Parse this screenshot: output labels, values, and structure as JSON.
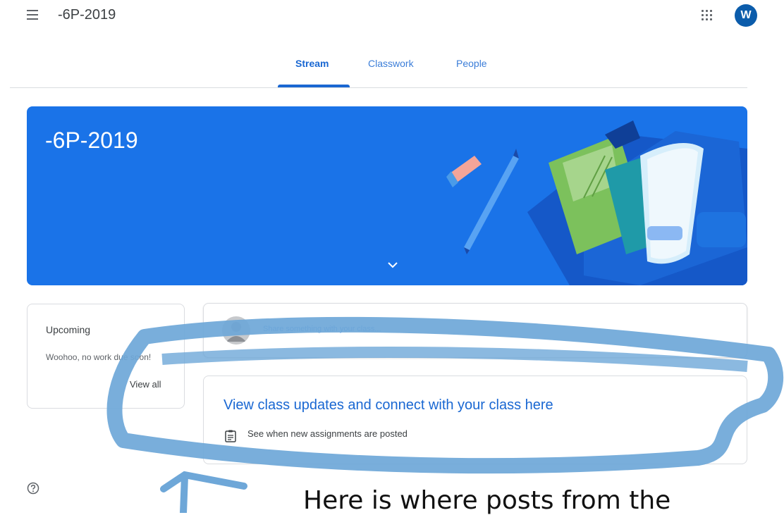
{
  "header": {
    "class_name": "-6P-2019",
    "avatar_letter": "W",
    "icons": [
      "menu-icon",
      "apps-icon",
      "account-avatar"
    ]
  },
  "tabs": [
    {
      "label": "Stream",
      "active": true
    },
    {
      "label": "Classwork",
      "active": false
    },
    {
      "label": "People",
      "active": false
    }
  ],
  "banner": {
    "title": "-6P-2019",
    "icons": [
      "chevron-down-icon"
    ]
  },
  "upcoming": {
    "title": "Upcoming",
    "text": "Woohoo, no work due soon!",
    "link": "View all"
  },
  "share": {
    "placeholder": "Share something with your class..."
  },
  "info_card": {
    "title": "View class updates and connect with your class here",
    "item": "See when new assignments are posted",
    "icons": [
      "assignment-icon"
    ]
  },
  "annotation": {
    "text": "Here is where posts from the"
  },
  "colors": {
    "accent": "#1967d2",
    "banner": "#1a73e8",
    "annotation_stroke": "#6ea7d8"
  }
}
